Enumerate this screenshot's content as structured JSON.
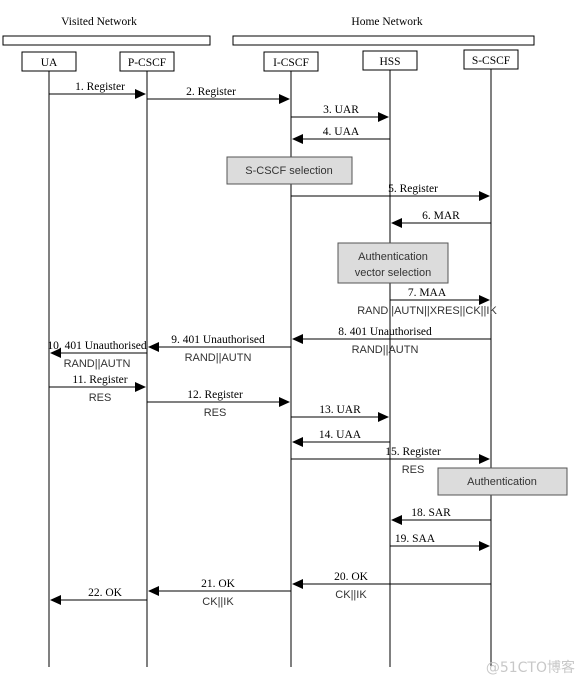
{
  "networks": {
    "visited": "Visited Network",
    "home": "Home Network"
  },
  "entities": [
    "UA",
    "P-CSCF",
    "I-CSCF",
    "HSS",
    "S-CSCF"
  ],
  "process_boxes": {
    "scscf_selection": "S-CSCF selection",
    "auth_vector_line1": "Authentication",
    "auth_vector_line2": "vector selection",
    "authentication": "Authentication"
  },
  "messages": [
    {
      "label": "1. Register",
      "sub": "",
      "from": "UA",
      "to": "P-CSCF"
    },
    {
      "label": "2. Register",
      "sub": "",
      "from": "P-CSCF",
      "to": "I-CSCF"
    },
    {
      "label": "3. UAR",
      "sub": "",
      "from": "I-CSCF",
      "to": "HSS"
    },
    {
      "label": "4. UAA",
      "sub": "",
      "from": "HSS",
      "to": "I-CSCF"
    },
    {
      "label": "5. Register",
      "sub": "",
      "from": "I-CSCF",
      "to": "S-CSCF"
    },
    {
      "label": "6. MAR",
      "sub": "",
      "from": "S-CSCF",
      "to": "HSS"
    },
    {
      "label": "7. MAA",
      "sub": "RAND||AUTN||XRES||CK||IK",
      "from": "HSS",
      "to": "S-CSCF"
    },
    {
      "label": "8. 401 Unauthorised",
      "sub": "RAND||AUTN",
      "from": "S-CSCF",
      "to": "I-CSCF"
    },
    {
      "label": "9. 401 Unauthorised",
      "sub": "RAND||AUTN",
      "from": "I-CSCF",
      "to": "P-CSCF"
    },
    {
      "label": "10. 401 Unauthorised",
      "sub": "RAND||AUTN",
      "from": "P-CSCF",
      "to": "UA"
    },
    {
      "label": "11. Register",
      "sub": "RES",
      "from": "UA",
      "to": "P-CSCF"
    },
    {
      "label": "12. Register",
      "sub": "RES",
      "from": "P-CSCF",
      "to": "I-CSCF"
    },
    {
      "label": "13. UAR",
      "sub": "",
      "from": "I-CSCF",
      "to": "HSS"
    },
    {
      "label": "14. UAA",
      "sub": "",
      "from": "HSS",
      "to": "I-CSCF"
    },
    {
      "label": "15. Register",
      "sub": "RES",
      "from": "I-CSCF",
      "to": "S-CSCF"
    },
    {
      "label": "18. SAR",
      "sub": "",
      "from": "S-CSCF",
      "to": "HSS"
    },
    {
      "label": "19. SAA",
      "sub": "",
      "from": "HSS",
      "to": "S-CSCF"
    },
    {
      "label": "20. OK",
      "sub": "CK||IK",
      "from": "S-CSCF",
      "to": "I-CSCF"
    },
    {
      "label": "21. OK",
      "sub": "CK||IK",
      "from": "I-CSCF",
      "to": "P-CSCF"
    },
    {
      "label": "22. OK",
      "sub": "",
      "from": "P-CSCF",
      "to": "UA"
    }
  ],
  "watermark": "@51CTO博客",
  "colors": {
    "process_box": "#dcdcdc",
    "line": "#000000"
  }
}
